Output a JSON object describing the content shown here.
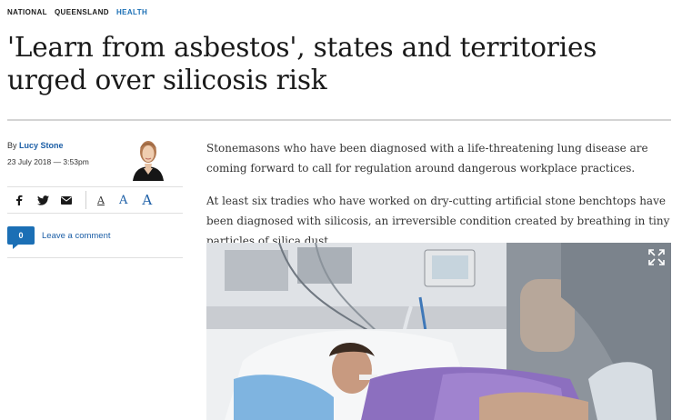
{
  "breadcrumb": {
    "items": [
      {
        "label": "NATIONAL"
      },
      {
        "label": "QUEENSLAND"
      },
      {
        "label": "HEALTH"
      }
    ]
  },
  "article": {
    "headline": "'Learn from asbestos', states and territories urged over silicosis risk",
    "byline_prefix": "By",
    "author": "Lucy Stone",
    "dateline": "23 July 2018 — 3:53pm",
    "paragraphs": [
      "Stonemasons who have been diagnosed with a life-threatening lung disease are coming forward to call for regulation around dangerous workplace practices.",
      "At least six tradies who have worked on dry-cutting artificial stone benchtops have been diagnosed with silicosis, an irreversible condition created by breathing in tiny particles of silica dust."
    ]
  },
  "share": {
    "icons": [
      "facebook-icon",
      "twitter-icon",
      "email-icon"
    ],
    "font_sizes": [
      "A",
      "A",
      "A"
    ]
  },
  "comments": {
    "count": "0",
    "link_label": "Leave a comment"
  },
  "colors": {
    "accent": "#1b6fb5",
    "link": "#1b5ea6"
  }
}
